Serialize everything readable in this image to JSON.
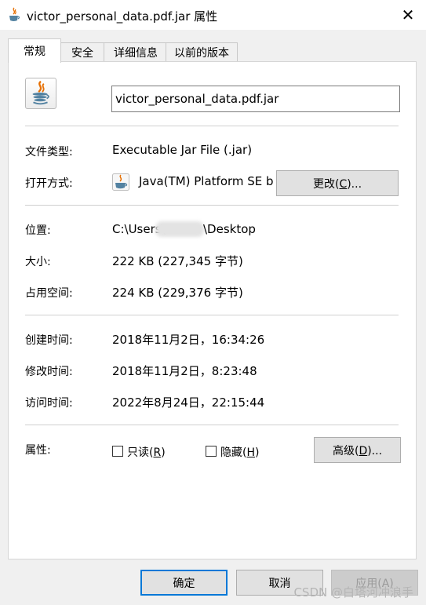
{
  "window": {
    "title": "victor_personal_data.pdf.jar 属性",
    "close_glyph": "✕"
  },
  "tabs": [
    {
      "label": "常规",
      "active": true
    },
    {
      "label": "安全",
      "active": false
    },
    {
      "label": "详细信息",
      "active": false
    },
    {
      "label": "以前的版本",
      "active": false
    }
  ],
  "general": {
    "file_name": "victor_personal_data.pdf.jar",
    "file_type_label": "文件类型:",
    "file_type_value": "Executable Jar File (.jar)",
    "open_with_label": "打开方式:",
    "open_with_value": "Java(TM) Platform SE b",
    "change_button": {
      "prefix": "更改(",
      "key": "C",
      "suffix": ")..."
    },
    "location_label": "位置:",
    "location_prefix": "C:\\Users\\",
    "location_suffix": "\\Desktop",
    "size_label": "大小:",
    "size_value": "222 KB (227,345 字节)",
    "size_on_disk_label": "占用空间:",
    "size_on_disk_value": "224 KB (229,376 字节)",
    "created_label": "创建时间:",
    "created_value": "2018年11月2日，16:34:26",
    "modified_label": "修改时间:",
    "modified_value": "2018年11月2日，8:23:48",
    "accessed_label": "访问时间:",
    "accessed_value": "2022年8月24日，22:15:44",
    "attributes_label": "属性:",
    "readonly": {
      "prefix": "只读(",
      "key": "R",
      "suffix": ")",
      "checked": false
    },
    "hidden": {
      "prefix": "隐藏(",
      "key": "H",
      "suffix": ")",
      "checked": false
    },
    "advanced_button": {
      "prefix": "高级(",
      "key": "D",
      "suffix": ")..."
    }
  },
  "footer": {
    "ok": "确定",
    "cancel": "取消",
    "apply": "应用(A)"
  },
  "watermark": "CSDN @白塔河冲浪手",
  "colors": {
    "accent": "#0078d7",
    "java_orange": "#e76f00",
    "java_blue": "#5382a1"
  }
}
